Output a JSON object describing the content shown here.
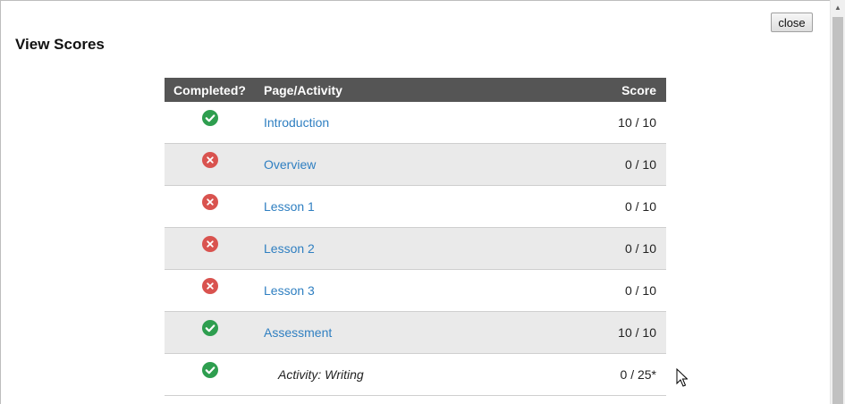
{
  "dialog": {
    "title": "View Scores",
    "close_label": "close"
  },
  "table": {
    "headers": {
      "completed": "Completed?",
      "page": "Page/Activity",
      "score": "Score"
    },
    "rows": [
      {
        "completed": true,
        "status_icon": "check-circle-icon",
        "label": "Introduction",
        "score": "10 / 10",
        "kind": "link"
      },
      {
        "completed": false,
        "status_icon": "x-circle-icon",
        "label": "Overview",
        "score": "0 / 10",
        "kind": "link"
      },
      {
        "completed": false,
        "status_icon": "x-circle-icon",
        "label": "Lesson 1",
        "score": "0 / 10",
        "kind": "link"
      },
      {
        "completed": false,
        "status_icon": "x-circle-icon",
        "label": "Lesson 2",
        "score": "0 / 10",
        "kind": "link"
      },
      {
        "completed": false,
        "status_icon": "x-circle-icon",
        "label": "Lesson 3",
        "score": "0 / 10",
        "kind": "link"
      },
      {
        "completed": true,
        "status_icon": "check-circle-icon",
        "label": "Assessment",
        "score": "10 / 10",
        "kind": "link"
      },
      {
        "completed": true,
        "status_icon": "check-circle-icon",
        "label": "Activity: Writing",
        "score": "0 / 25*",
        "kind": "activity"
      }
    ]
  },
  "colors": {
    "header_bg": "#555555",
    "link": "#2f7fc1",
    "check": "#2e9e4f",
    "cross": "#d9534f",
    "row_alt": "#eaeaea"
  }
}
